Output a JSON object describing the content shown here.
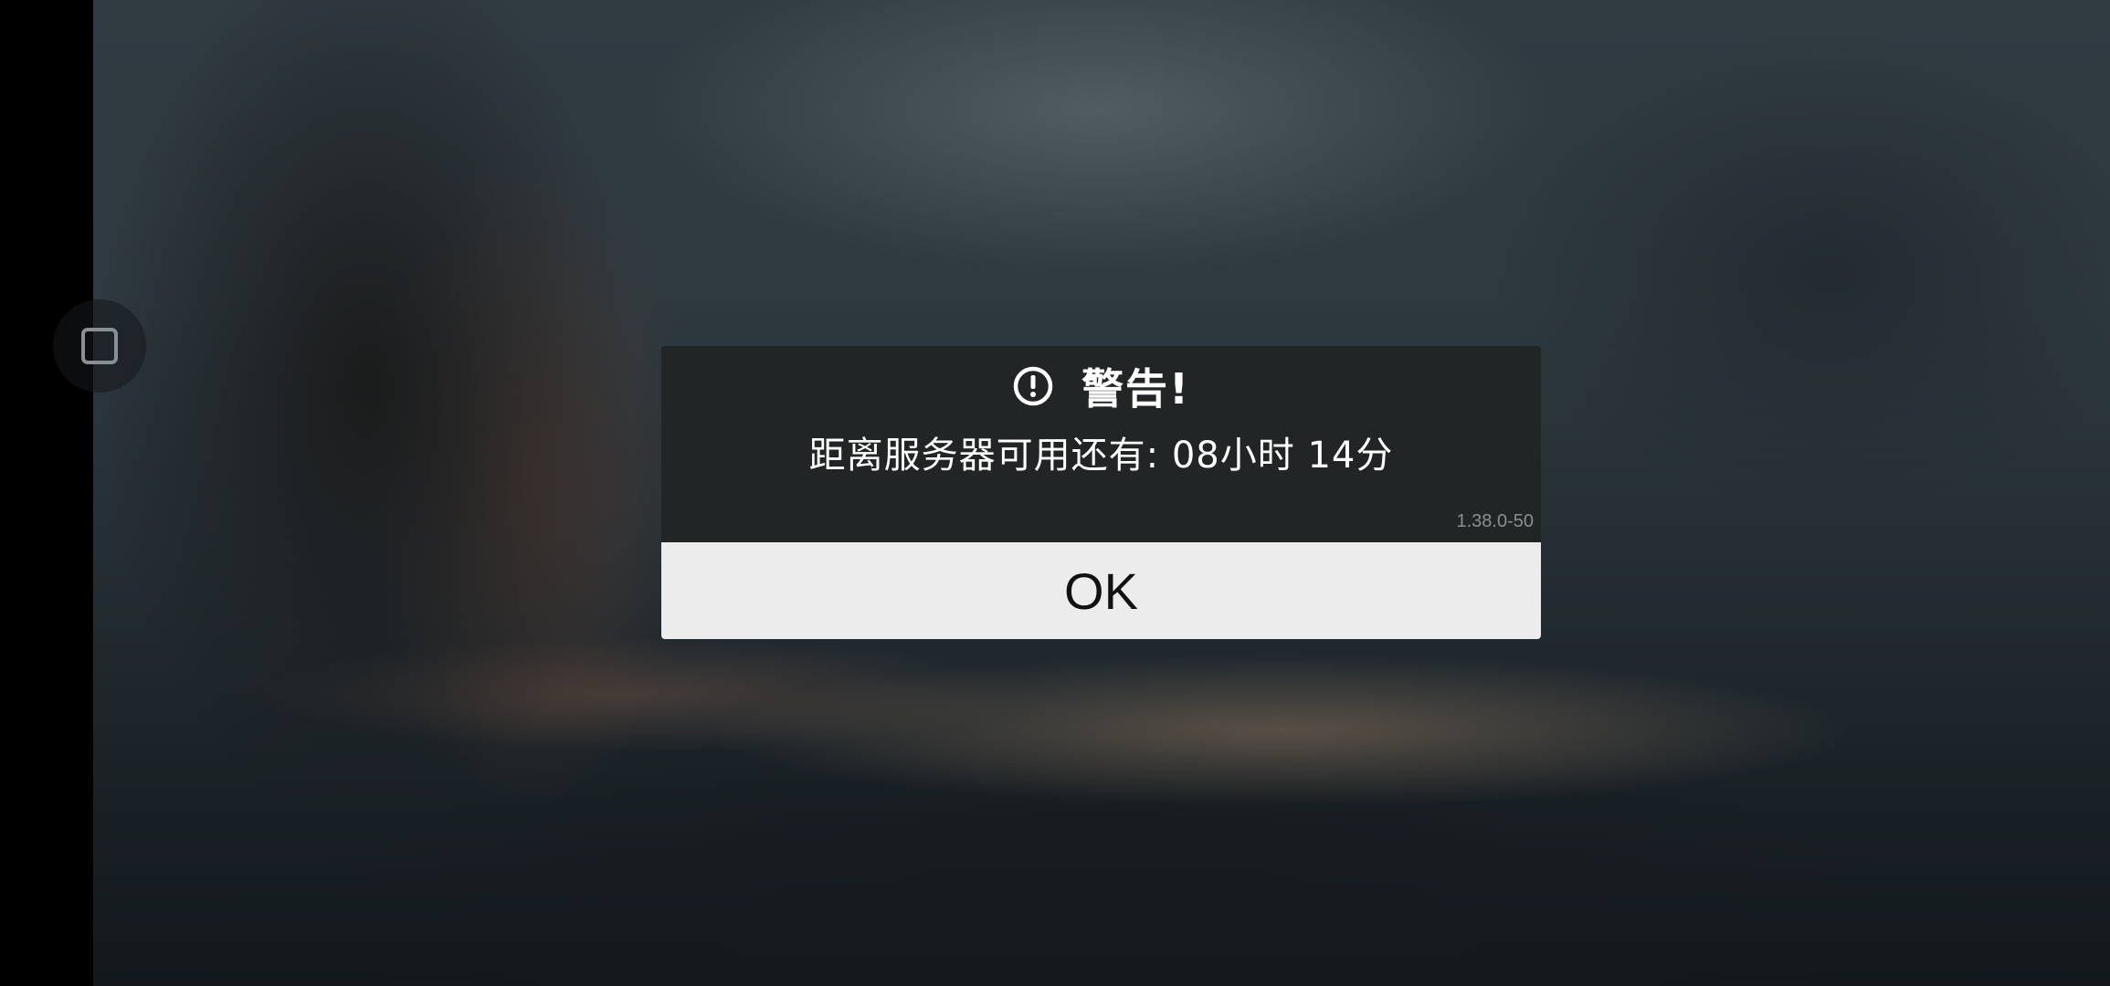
{
  "dialog": {
    "title": "警告!",
    "message": "距离服务器可用还有:  08小时 14分",
    "version": "1.38.0-50",
    "ok_label": "OK",
    "icon": "warning-circle-icon"
  },
  "side_button": {
    "icon": "square-icon"
  },
  "colors": {
    "dialog_background": "#222526",
    "button_background": "#ececec",
    "title_text": "#ffffff",
    "version_text": "#8c8f91"
  }
}
